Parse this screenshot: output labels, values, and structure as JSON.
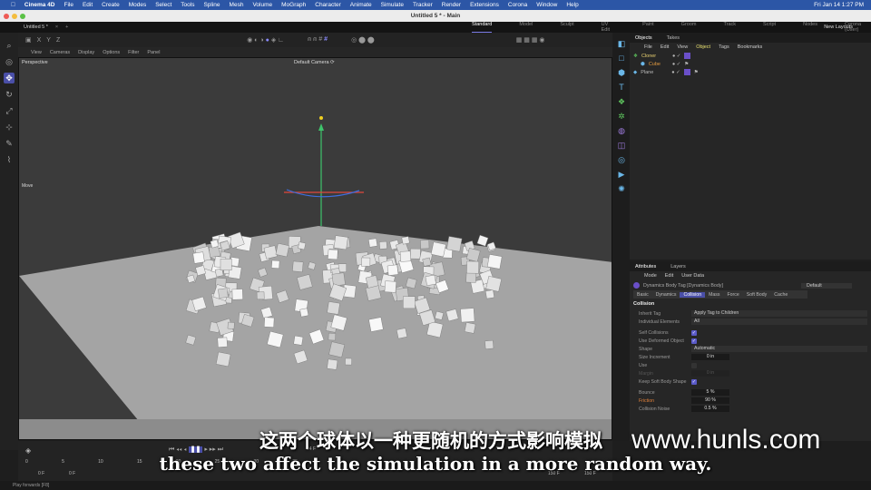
{
  "menubar": {
    "app": "Cinema 4D",
    "items": [
      "File",
      "Edit",
      "Create",
      "Modes",
      "Select",
      "Tools",
      "Spline",
      "Mesh",
      "Volume",
      "MoGraph",
      "Character",
      "Animate",
      "Simulate",
      "Tracker",
      "Render",
      "Extensions",
      "Corona",
      "Window",
      "Help"
    ],
    "clock": "Fri Jan 14  1:27 PM"
  },
  "window": {
    "title": "Untitled 5 * - Main",
    "doc_tab": "Untitled 5 *"
  },
  "layouts": {
    "items": [
      "Standard",
      "Model",
      "Sculpt",
      "UV Edit",
      "Paint",
      "Groom",
      "Track",
      "Script",
      "Nodes",
      "Corona (User)"
    ],
    "new_layouts": "New Layouts"
  },
  "toolbar": {
    "axes": [
      "X",
      "Y",
      "Z"
    ]
  },
  "viewport": {
    "menu": [
      "View",
      "Cameras",
      "Display",
      "Options",
      "Filter",
      "Panel"
    ],
    "label": "Perspective",
    "camera": "Default Camera ⟳",
    "move": "Move"
  },
  "objects": {
    "tabs": [
      "Objects",
      "Takes"
    ],
    "menu": [
      "File",
      "Edit",
      "View",
      "Object",
      "Tags",
      "Bookmarks"
    ],
    "items": [
      {
        "name": "Cloner",
        "color": "#e8d070"
      },
      {
        "name": "Cube",
        "color": "#e09a40"
      },
      {
        "name": "Plane",
        "color": "#cccccc"
      }
    ]
  },
  "attributes": {
    "tabs": [
      "Attributes",
      "Layers"
    ],
    "menu": [
      "Mode",
      "Edit",
      "User Data"
    ],
    "tag": "Dynamics Body Tag [Dynamics Body]",
    "preset": "Default",
    "subtabs": [
      "Basic",
      "Dynamics",
      "Collision",
      "Mass",
      "Force",
      "Soft Body",
      "Cache"
    ],
    "section": "Collision",
    "inherit_tag": {
      "label": "Inherit Tag",
      "value": "Apply Tag to Children"
    },
    "individual_elements": {
      "label": "Individual Elements",
      "value": "All"
    },
    "self_collisions": "Self Collisions",
    "use_deformed": "Use Deformed Object",
    "shape": {
      "label": "Shape",
      "value": "Automatic"
    },
    "size_increment": {
      "label": "Size Increment",
      "value": "0 in"
    },
    "use": "Use",
    "margin": {
      "label": "Margin",
      "value": "0 in"
    },
    "keep_soft": "Keep Soft Body Shape",
    "bounce": {
      "label": "Bounce",
      "value": "5 %"
    },
    "friction": {
      "label": "Friction",
      "value": "90 %"
    },
    "collision_noise": {
      "label": "Collision Noise",
      "value": "0.5 %"
    }
  },
  "timeline": {
    "ticks": [
      "0",
      "5",
      "10",
      "15",
      "20",
      "25",
      "30",
      "35"
    ],
    "start": "0 F",
    "current": "0 F",
    "fps": "24 F",
    "end_a": "150 F",
    "end_b": "150 F"
  },
  "status": "Play forwards [F8]",
  "subtitles": {
    "cn": "这两个球体以一种更随机的方式影响模拟",
    "en": "these two affect the simulation in a more random way."
  },
  "watermark": "www.hunls.com"
}
